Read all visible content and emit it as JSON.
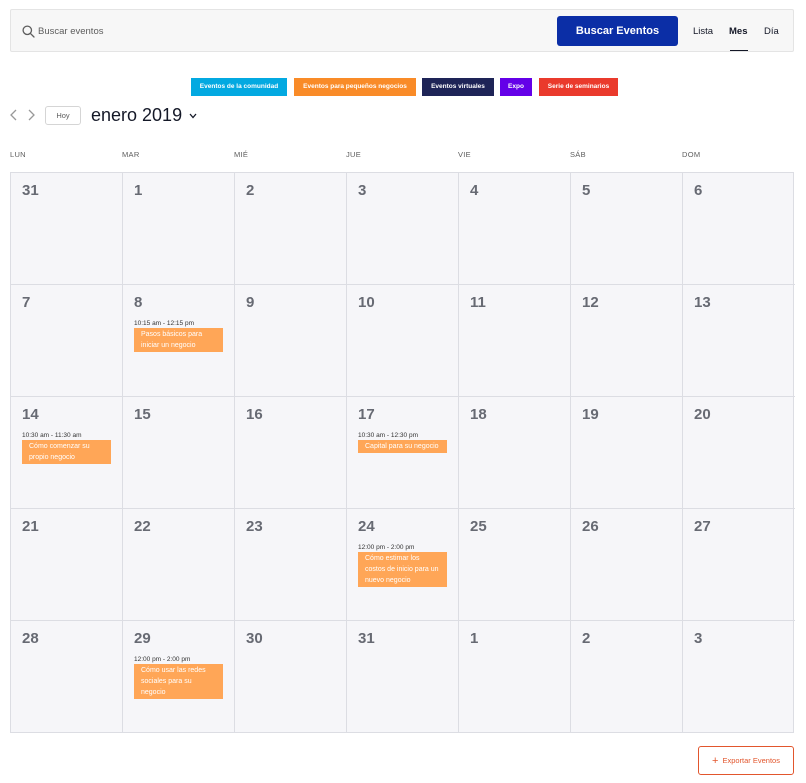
{
  "search": {
    "placeholder": "Buscar eventos",
    "button_label": "Buscar Eventos",
    "views": [
      "Lista",
      "Mes",
      "Día"
    ],
    "active_view": "Mes"
  },
  "categories": [
    {
      "label": "Eventos de la comunidad",
      "color": "#03a9e1"
    },
    {
      "label": "Eventos para pequeños negocios",
      "color": "#f98b28"
    },
    {
      "label": "Eventos virtuales",
      "color": "#1e2457"
    },
    {
      "label": "Expo",
      "color": "#6400e8"
    },
    {
      "label": "Serie de seminarios",
      "color": "#ea3a2c"
    }
  ],
  "nav": {
    "today_label": "Hoy",
    "month_title": "enero 2019"
  },
  "weekdays": [
    "LUN",
    "MAR",
    "MIÉ",
    "JUE",
    "VIE",
    "SÁB",
    "DOM"
  ],
  "weeks": [
    [
      {
        "day": "31"
      },
      {
        "day": "1"
      },
      {
        "day": "2"
      },
      {
        "day": "3"
      },
      {
        "day": "4"
      },
      {
        "day": "5"
      },
      {
        "day": "6"
      }
    ],
    [
      {
        "day": "7"
      },
      {
        "day": "8",
        "event": {
          "time": "10:15 am - 12:15 pm",
          "title": "Pasos básicos para iniciar un negocio"
        }
      },
      {
        "day": "9"
      },
      {
        "day": "10"
      },
      {
        "day": "11"
      },
      {
        "day": "12"
      },
      {
        "day": "13"
      }
    ],
    [
      {
        "day": "14",
        "event": {
          "time": "10:30 am - 11:30 am",
          "title": "Cómo comenzar su propio negocio"
        }
      },
      {
        "day": "15"
      },
      {
        "day": "16"
      },
      {
        "day": "17",
        "event": {
          "time": "10:30 am - 12:30 pm",
          "title": "Capital para su negocio"
        }
      },
      {
        "day": "18"
      },
      {
        "day": "19"
      },
      {
        "day": "20"
      }
    ],
    [
      {
        "day": "21"
      },
      {
        "day": "22"
      },
      {
        "day": "23"
      },
      {
        "day": "24",
        "event": {
          "time": "12:00 pm - 2:00 pm",
          "title": "Cómo estimar los costos de inicio para un nuevo negocio"
        }
      },
      {
        "day": "25"
      },
      {
        "day": "26"
      },
      {
        "day": "27"
      }
    ],
    [
      {
        "day": "28"
      },
      {
        "day": "29",
        "event": {
          "time": "12:00 pm - 2:00 pm",
          "title": "Cómo usar las redes sociales para su negocio"
        }
      },
      {
        "day": "30"
      },
      {
        "day": "31"
      },
      {
        "day": "1"
      },
      {
        "day": "2"
      },
      {
        "day": "3"
      }
    ]
  ],
  "export": {
    "label": "Exportar Eventos"
  },
  "colors": {
    "primary": "#0b2ea6",
    "event": "#ffa657",
    "export": "#e2562d"
  }
}
